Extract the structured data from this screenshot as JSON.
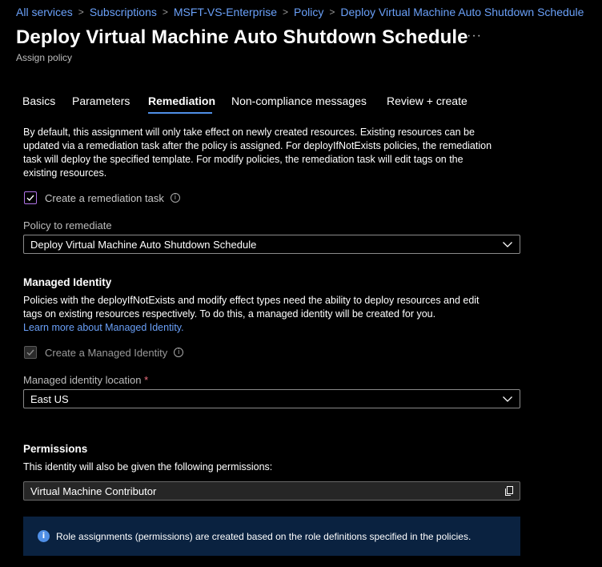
{
  "breadcrumb": [
    "All services",
    "Subscriptions",
    "MSFT-VS-Enterprise",
    "Policy",
    "Deploy Virtual Machine Auto Shutdown Schedule"
  ],
  "page": {
    "title": "Deploy Virtual Machine Auto Shutdown Schedule",
    "more_label": "···",
    "subtitle": "Assign policy"
  },
  "tabs": [
    "Basics",
    "Parameters",
    "Remediation",
    "Non-compliance messages",
    "Review + create"
  ],
  "active_tab": "Remediation",
  "remediation": {
    "intro_lines": [
      "By default, this assignment will only take effect on newly created resources. Existing resources can be",
      "updated via a remediation task after the policy is assigned. For deployIfNotExists policies, the remediation",
      "task will deploy the specified template. For modify policies, the remediation task will edit tags on the",
      "existing resources."
    ],
    "create_task_label": "Create a remediation task",
    "create_task_checked": true,
    "policy_label": "Policy to remediate",
    "policy_value": "Deploy Virtual Machine Auto Shutdown Schedule"
  },
  "managed_identity": {
    "heading": "Managed Identity",
    "para_lines": [
      "Policies with the deployIfNotExists and modify effect types need the ability to deploy resources and edit",
      "tags on existing resources respectively. To do this, a managed identity will be created for you."
    ],
    "learn_more": "Learn more about Managed Identity.",
    "create_identity_label": "Create a Managed Identity",
    "create_identity_checked": true,
    "location_label": "Managed identity location",
    "required_mark": "*",
    "location_value": "East US"
  },
  "permissions": {
    "heading": "Permissions",
    "description": "This identity will also be given the following permissions:",
    "role": "Virtual Machine Contributor"
  },
  "infobar": {
    "message": "Role assignments (permissions) are created based on the role definitions specified in the policies."
  },
  "icons": {
    "info": "info-icon",
    "chevron": "chevron-down-icon",
    "copy": "copy-icon",
    "check": "checkmark-icon"
  },
  "colors": {
    "background": "#000000",
    "link": "#6aa0f8",
    "tab_underline": "#4f8fe6",
    "checkbox_border": "#b074e8",
    "infobar_bg": "#0a2240"
  }
}
